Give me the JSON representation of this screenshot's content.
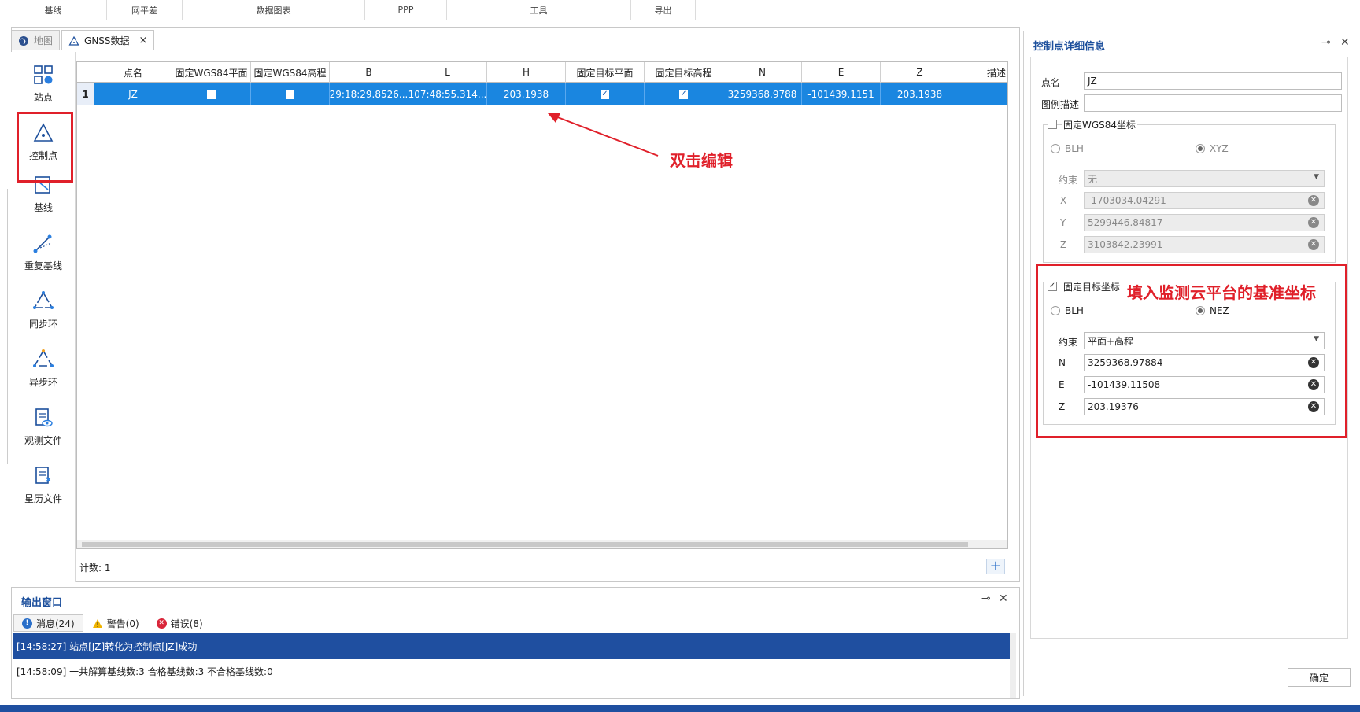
{
  "ribbon": {
    "groups": [
      "基线",
      "网平差",
      "数据图表",
      "PPP",
      "工具",
      "导出"
    ]
  },
  "tabs": {
    "map": "地图",
    "gnss": "GNSS数据",
    "close": "×"
  },
  "nav": {
    "items": [
      "站点",
      "控制点",
      "基线",
      "重复基线",
      "同步环",
      "异步环",
      "观测文件",
      "星历文件"
    ]
  },
  "grid": {
    "columns": [
      "点名",
      "固定WGS84平面",
      "固定WGS84高程",
      "B",
      "L",
      "H",
      "固定目标平面",
      "固定目标高程",
      "N",
      "E",
      "Z",
      "描述"
    ],
    "rows": [
      {
        "index": "1",
        "name": "JZ",
        "fix_wgs_plane": false,
        "fix_wgs_height": false,
        "B": "29:18:29.8526...",
        "L": "107:48:55.314...",
        "H": "203.1938",
        "fix_target_plane": true,
        "fix_target_height": true,
        "N": "3259368.9788",
        "E": "-101439.1151",
        "Z": "203.1938",
        "desc": ""
      }
    ],
    "count_label": "计数:",
    "count_value": "1",
    "add_label": "+"
  },
  "annotations": {
    "double_click": "双击编辑",
    "fill_in": "填入监测云平台的基准坐标"
  },
  "output": {
    "title": "输出窗口",
    "pin": "⊸",
    "close": "✕",
    "tabs": [
      {
        "label": "消息(24)",
        "color": "#2a6fc9",
        "glyph": "!"
      },
      {
        "label": "警告(0)",
        "color": "#f0b400",
        "glyph": "!"
      },
      {
        "label": "错误(8)",
        "color": "#d9263a",
        "glyph": "✕"
      }
    ],
    "lines": [
      "[14:58:27] 站点[JZ]转化为控制点[JZ]成功",
      "[14:58:09] 一共解算基线数:3 合格基线数:3 不合格基线数:0"
    ]
  },
  "detail": {
    "title": "控制点详细信息",
    "pin": "⊸",
    "close": "✕",
    "name_label": "点名",
    "name_value": "JZ",
    "legend_label": "图例描述",
    "legend_value": "",
    "fix_wgs_label": "固定WGS84坐标",
    "fix_wgs_checked": false,
    "wgs_radio_blh": "BLH",
    "wgs_radio_xyz": "XYZ",
    "wgs_constraint_label": "约束",
    "wgs_constraint_value": "无",
    "wgs_x_label": "X",
    "wgs_x_value": "-1703034.04291",
    "wgs_y_label": "Y",
    "wgs_y_value": "5299446.84817",
    "wgs_z_label": "Z",
    "wgs_z_value": "3103842.23991",
    "fix_target_label": "固定目标坐标",
    "fix_target_checked": true,
    "target_radio_blh": "BLH",
    "target_radio_nez": "NEZ",
    "target_constraint_label": "约束",
    "target_constraint_value": "平面+高程",
    "target_n_label": "N",
    "target_n_value": "3259368.97884",
    "target_e_label": "E",
    "target_e_value": "-101439.11508",
    "target_z_label": "Z",
    "target_z_value": "203.19376",
    "ok_label": "确定"
  },
  "colors": {
    "accent": "#1a86e0",
    "highlight": "#e0202a",
    "title_blue": "#1c4f9c"
  }
}
